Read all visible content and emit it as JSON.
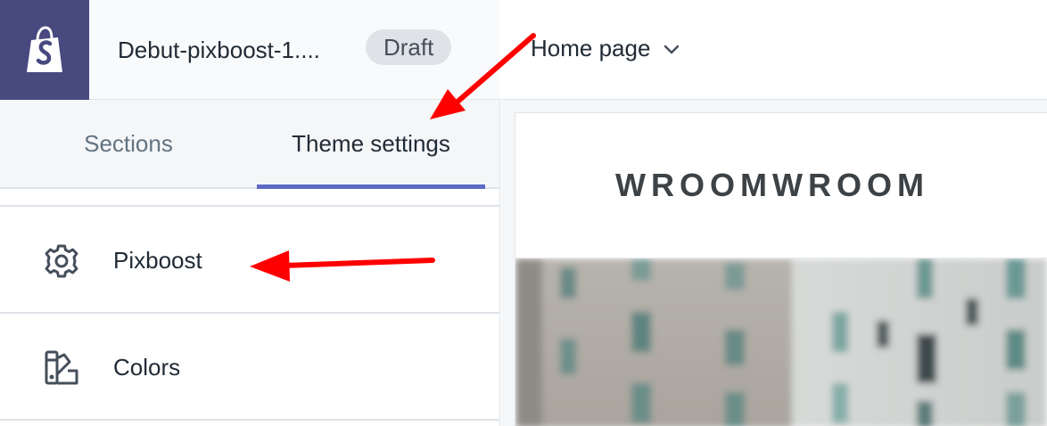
{
  "header": {
    "logo_icon": "shopify-bag-icon",
    "theme_name": "Debut-pixboost-1....",
    "badge": "Draft"
  },
  "tabs": [
    {
      "label": "Sections",
      "active": false
    },
    {
      "label": "Theme settings",
      "active": true
    }
  ],
  "menu": [
    {
      "label": "Pixboost",
      "icon": "gear-icon"
    },
    {
      "label": "Colors",
      "icon": "color-palette-icon"
    }
  ],
  "preview": {
    "page_select": "Home page",
    "store_title": "WROOMWROOM"
  },
  "colors": {
    "logo_bg": "#47497f",
    "tab_accent": "#5c6ac4",
    "annotation_arrow": "#ff0000"
  }
}
